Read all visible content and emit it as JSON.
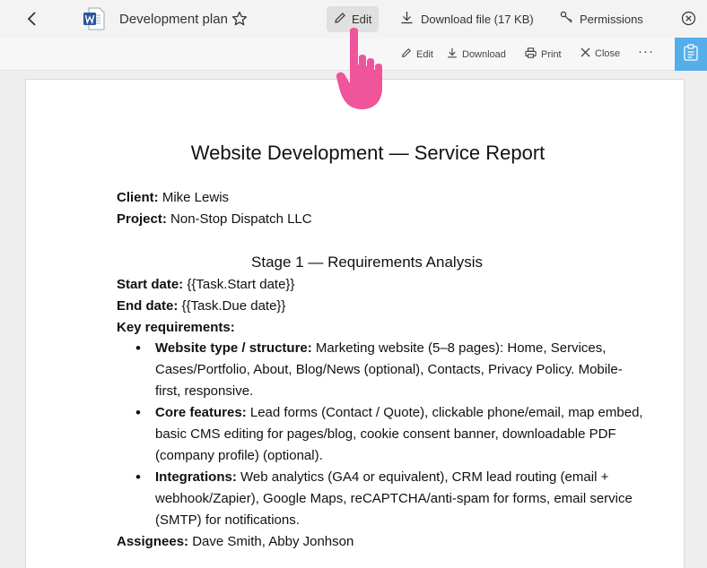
{
  "topbar": {
    "title": "Development plan",
    "edit_label": "Edit",
    "download_label": "Download file (17 KB)",
    "permissions_label": "Permissions",
    "icons": {
      "back": "chevron-left-icon",
      "app": "word-icon",
      "favorite": "star-icon",
      "close": "close-circle-icon"
    }
  },
  "toolbar": {
    "edit_label": "Edit",
    "download_label": "Download",
    "print_label": "Print",
    "close_label": "Close",
    "more_label": "···",
    "accent": "#55aeea"
  },
  "doc": {
    "title": "Website Development — Service Report",
    "client_label": "Client:",
    "client_value": " Mike Lewis",
    "project_label": "Project:",
    "project_value": " Non-Stop Dispatch LLC",
    "stage_title": "Stage 1 — Requirements Analysis",
    "start_label": "Start date:",
    "start_value": " {{Task.Start date}}",
    "end_label": "End date:",
    "end_value": " {{Task.Due date}}",
    "key_req_label": "Key requirements:",
    "requirements": [
      {
        "label": "Website type / structure:",
        "text": " Marketing website (5–8 pages): Home, Services, Cases/Portfolio, About, Blog/News (optional), Contacts, Privacy Policy. Mobile-first, responsive."
      },
      {
        "label": "Core features:",
        "text": " Lead forms (Contact / Quote), clickable phone/email, map embed, basic CMS editing for pages/blog, cookie consent banner, downloadable PDF (company profile) (optional)."
      },
      {
        "label": "Integrations:",
        "text": " Web analytics (GA4 or equivalent), CRM lead routing (email + webhook/Zapier), Google Maps, reCAPTCHA/anti-spam for forms, email service (SMTP) for notifications."
      }
    ],
    "assignees_label": "Assignees:",
    "assignees_value": " Dave Smith, Abby Jonhson"
  },
  "pointer": {
    "icon": "hand-pointer-icon",
    "color": "#f0549b"
  }
}
